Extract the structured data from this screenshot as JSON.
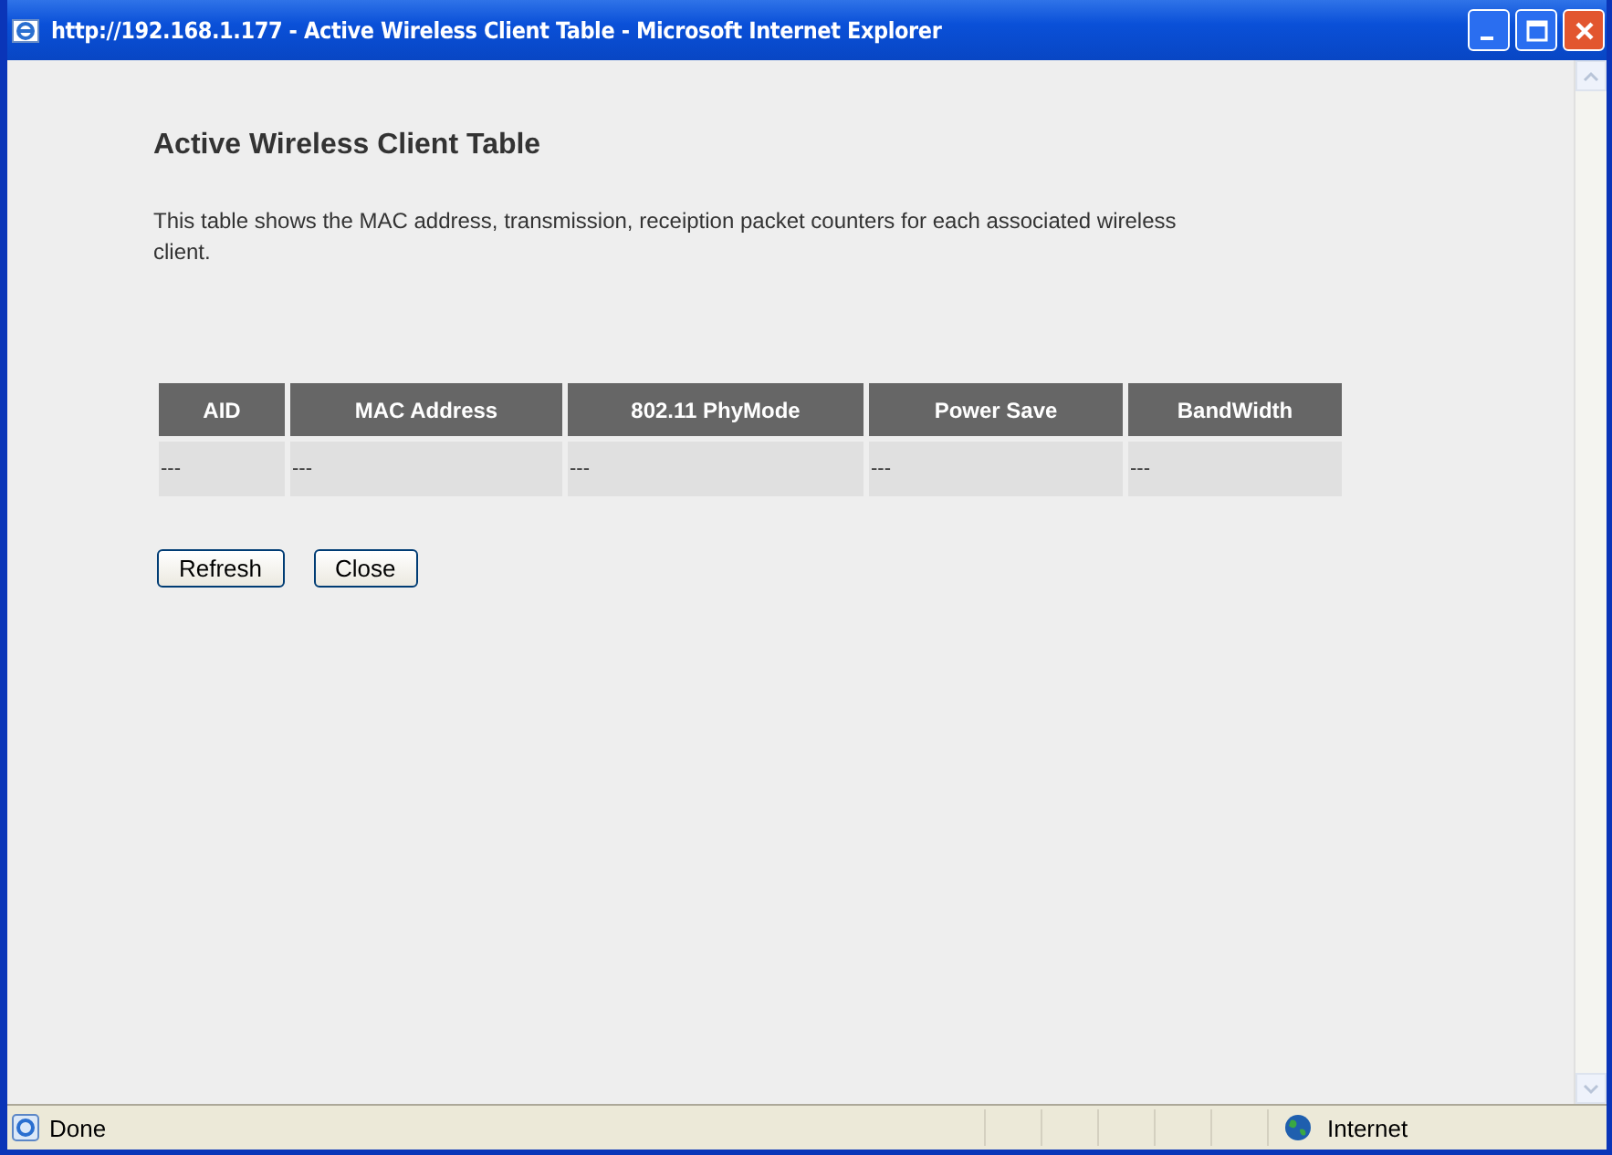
{
  "window": {
    "title": "http://192.168.1.177 - Active Wireless Client Table - Microsoft Internet Explorer"
  },
  "page": {
    "heading": "Active Wireless Client Table",
    "description": "This table shows the MAC address, transmission, receiption packet counters for each associated wireless client."
  },
  "table": {
    "columns": [
      "AID",
      "MAC Address",
      "802.11 PhyMode",
      "Power Save",
      "BandWidth"
    ],
    "rows": [
      [
        "---",
        "---",
        "---",
        "---",
        "---"
      ]
    ]
  },
  "buttons": [
    "Refresh",
    "Close"
  ],
  "status_bar": {
    "status": "Done",
    "zone": "Internet"
  }
}
